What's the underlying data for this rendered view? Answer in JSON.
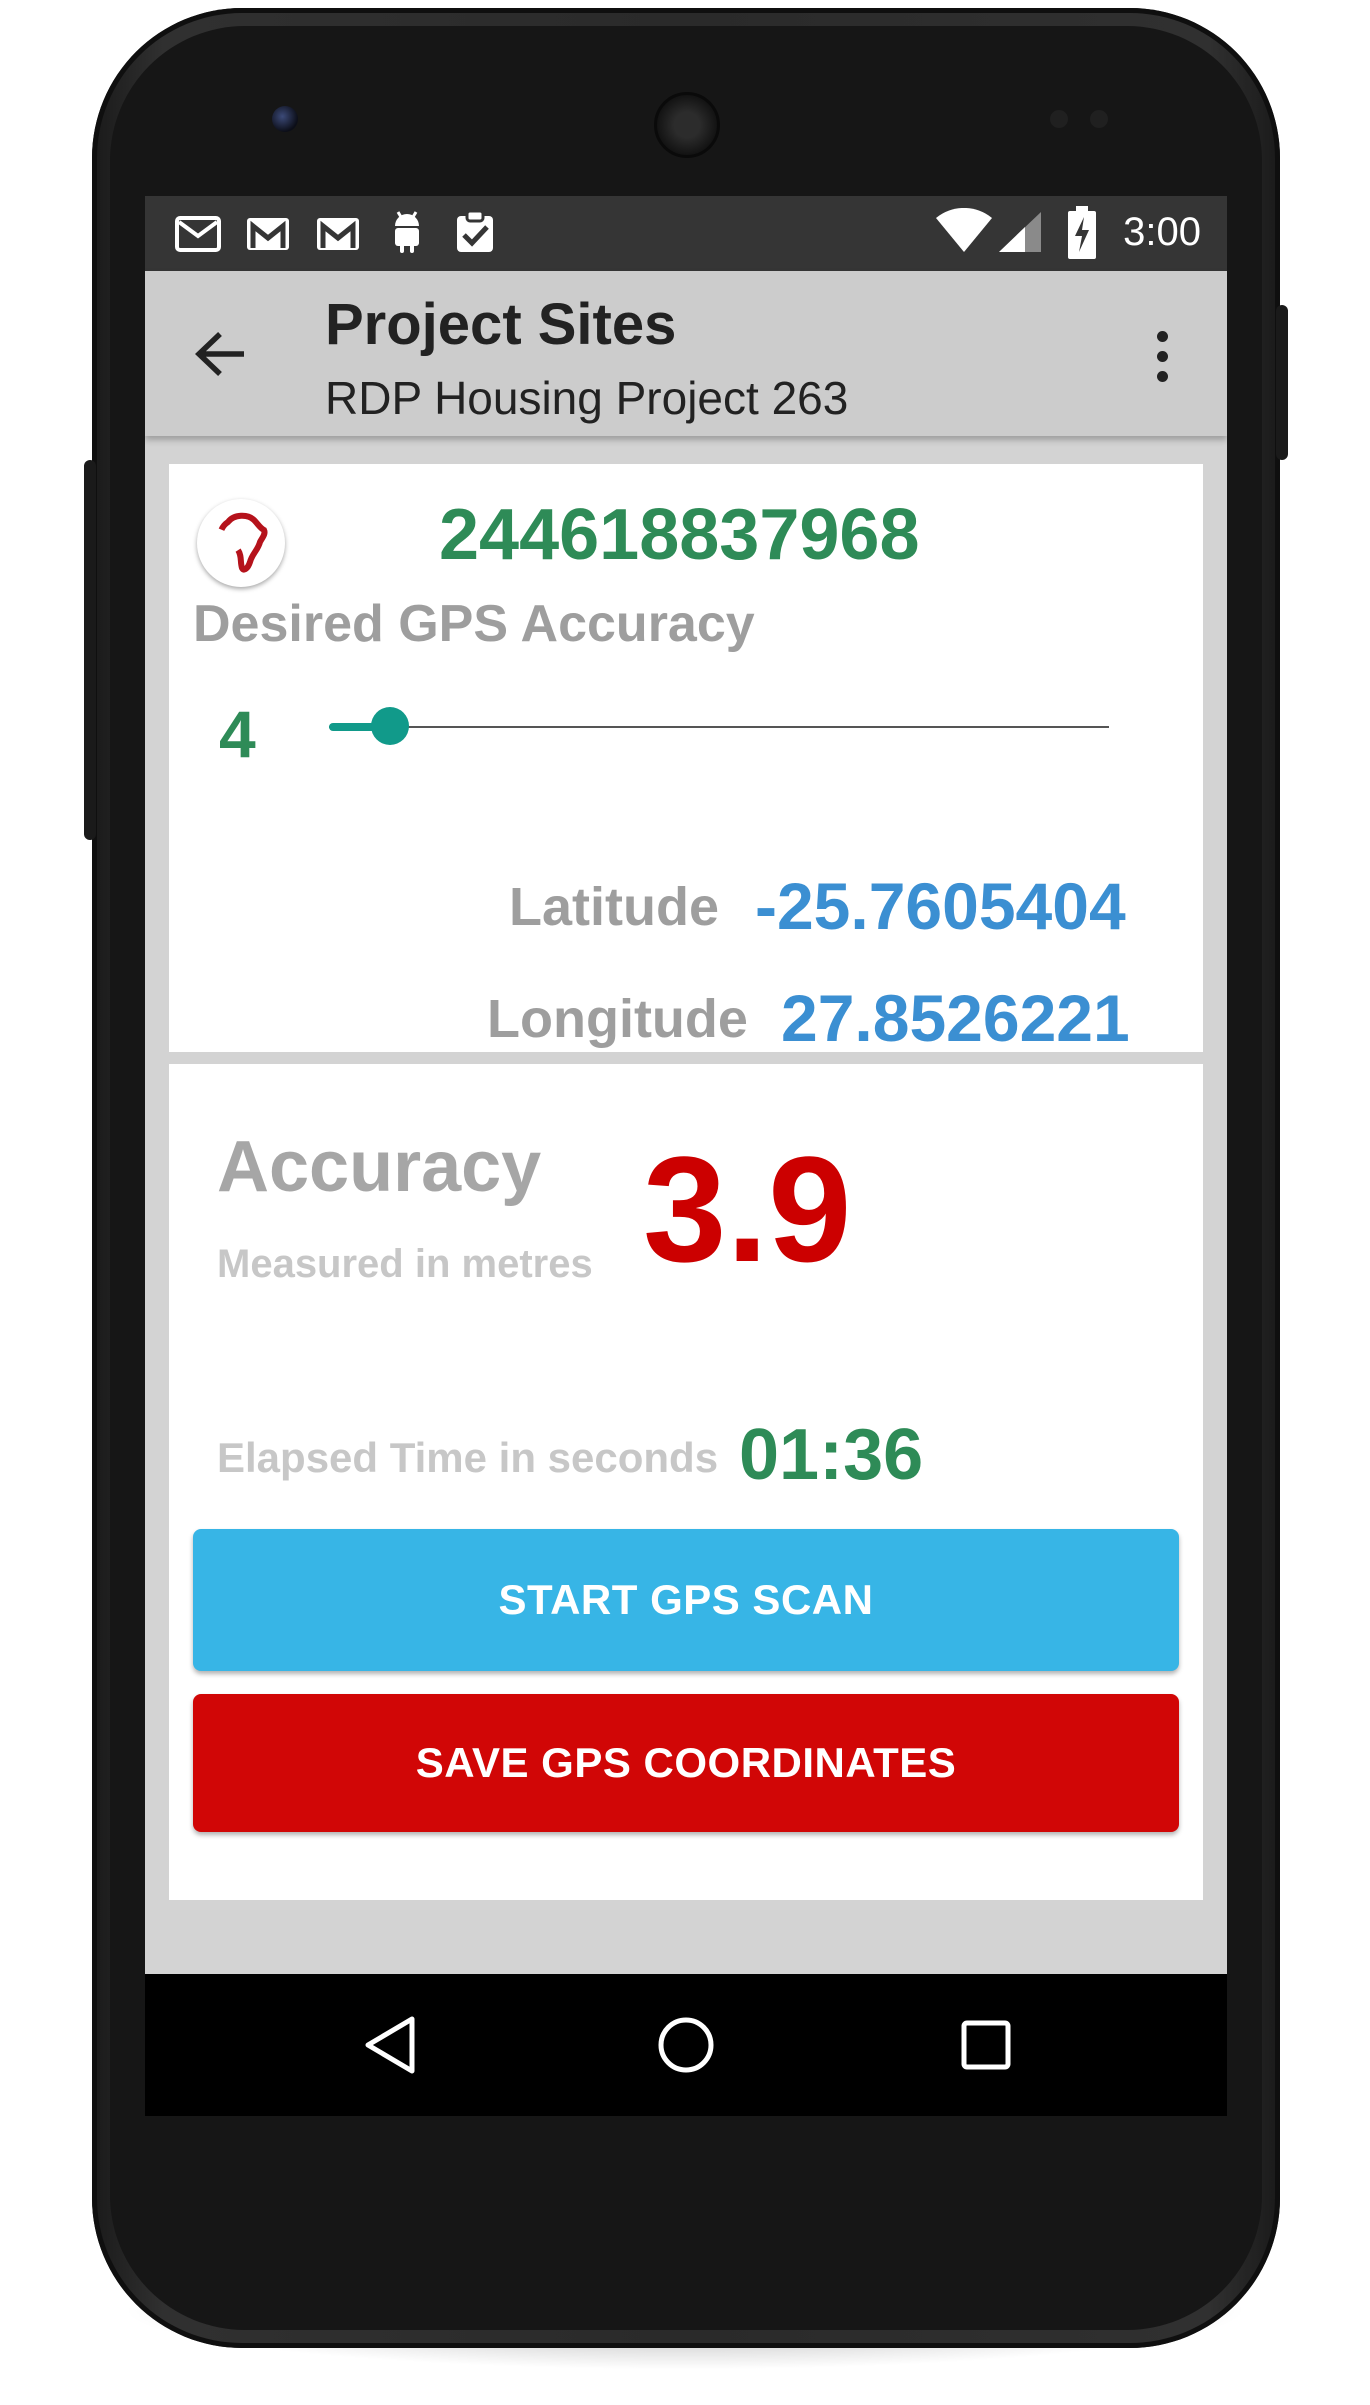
{
  "status_bar": {
    "time": "3:00",
    "notification_icons": [
      "gmail-outline-icon",
      "gmail-icon",
      "gmail-icon",
      "android-debug-icon",
      "clipboard-check-icon"
    ],
    "system_icons": [
      "wifi-icon",
      "cell-signal-icon",
      "battery-charging-icon"
    ]
  },
  "app_bar": {
    "title": "Project Sites",
    "subtitle": "RDP Housing Project 263"
  },
  "site_card": {
    "site_id": "244618837968",
    "desired_accuracy_label": "Desired GPS Accuracy",
    "desired_accuracy_value": "4",
    "latitude_label": "Latitude",
    "latitude_value": "-25.7605404",
    "longitude_label": "Longitude",
    "longitude_value": "27.8526221"
  },
  "scan_card": {
    "accuracy_title": "Accuracy",
    "accuracy_subtitle": "Measured in metres",
    "accuracy_value": "3.9",
    "elapsed_label": "Elapsed Time in seconds",
    "elapsed_value": "01:36",
    "start_button": "START GPS SCAN",
    "save_button": "SAVE GPS COORDINATES"
  },
  "colors": {
    "green": "#2e8b57",
    "blue": "#3b8fd2",
    "red": "#cc0000",
    "teal": "#119a8a",
    "scan_button": "#37b5e6",
    "save_button": "#d10606"
  }
}
